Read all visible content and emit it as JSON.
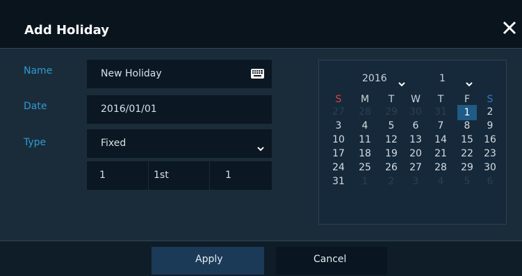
{
  "dialog": {
    "title": "Add Holiday",
    "close_icon": "close-icon"
  },
  "form": {
    "name_label": "Name",
    "name_value": "New Holiday",
    "keyboard_icon": "keyboard-icon",
    "date_label": "Date",
    "date_value": "2016/01/01",
    "type_label": "Type",
    "type_value": "Fixed",
    "chevron_icon": "chevron-down-icon",
    "extra": [
      "1",
      "1st",
      "1"
    ]
  },
  "calendar": {
    "year": "2016",
    "month": "1",
    "weekdays": [
      "S",
      "M",
      "T",
      "W",
      "T",
      "F",
      "S"
    ],
    "selected_day": "1",
    "rows": [
      [
        "27",
        "28",
        "29",
        "30",
        "31",
        "1",
        "2"
      ],
      [
        "3",
        "4",
        "5",
        "6",
        "7",
        "8",
        "9"
      ],
      [
        "10",
        "11",
        "12",
        "13",
        "14",
        "15",
        "16"
      ],
      [
        "17",
        "18",
        "19",
        "20",
        "21",
        "22",
        "23"
      ],
      [
        "24",
        "25",
        "26",
        "27",
        "28",
        "29",
        "30"
      ],
      [
        "31",
        "1",
        "2",
        "3",
        "4",
        "5",
        "6"
      ]
    ]
  },
  "buttons": {
    "apply_label": "Apply",
    "cancel_label": "Cancel"
  },
  "colors": {
    "accent": "#2e9bd3",
    "sunday": "#d9453c",
    "saturday": "#2e78c6",
    "selected": "#1f5b86"
  }
}
